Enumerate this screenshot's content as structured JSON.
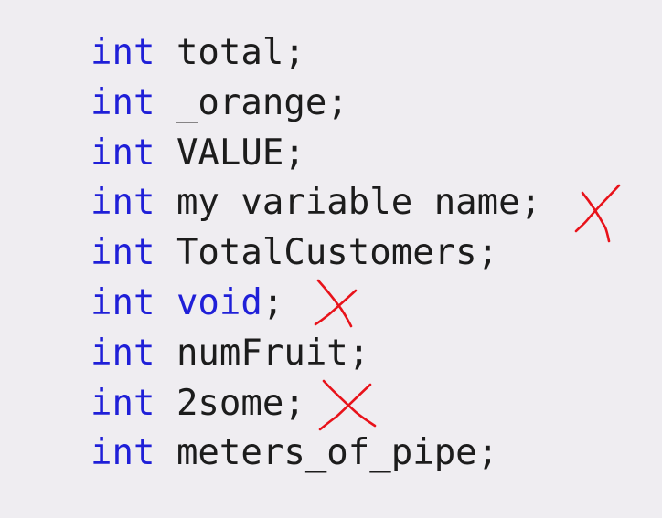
{
  "slide": {
    "code_lines": [
      {
        "keyword": "int",
        "name": "total",
        "end": ";",
        "name_is_keyword": false
      },
      {
        "keyword": "int",
        "name": "_orange",
        "end": ";",
        "name_is_keyword": false
      },
      {
        "keyword": "int",
        "name": "VALUE",
        "end": ";",
        "name_is_keyword": false
      },
      {
        "keyword": "int",
        "name": "my variable name",
        "end": ";",
        "name_is_keyword": false
      },
      {
        "keyword": "int",
        "name": "TotalCustomers",
        "end": ";",
        "name_is_keyword": false
      },
      {
        "keyword": "int",
        "name": "void",
        "end": ";",
        "name_is_keyword": true
      },
      {
        "keyword": "int",
        "name": "numFruit",
        "end": ";",
        "name_is_keyword": false
      },
      {
        "keyword": "int",
        "name": "2some",
        "end": ";",
        "name_is_keyword": false
      },
      {
        "keyword": "int",
        "name": "meters_of_pipe",
        "end": ";",
        "name_is_keyword": false
      }
    ],
    "annotations": [
      {
        "type": "cross-mark-icon",
        "line": 4,
        "color": "#e8121a"
      },
      {
        "type": "cross-mark-icon",
        "line": 6,
        "color": "#e8121a"
      },
      {
        "type": "cross-mark-icon",
        "line": 8,
        "color": "#e8121a"
      }
    ],
    "colors": {
      "background": "#efedf1",
      "keyword": "#1f1fd8",
      "text": "#1c1c1c",
      "mark": "#e8121a"
    }
  }
}
